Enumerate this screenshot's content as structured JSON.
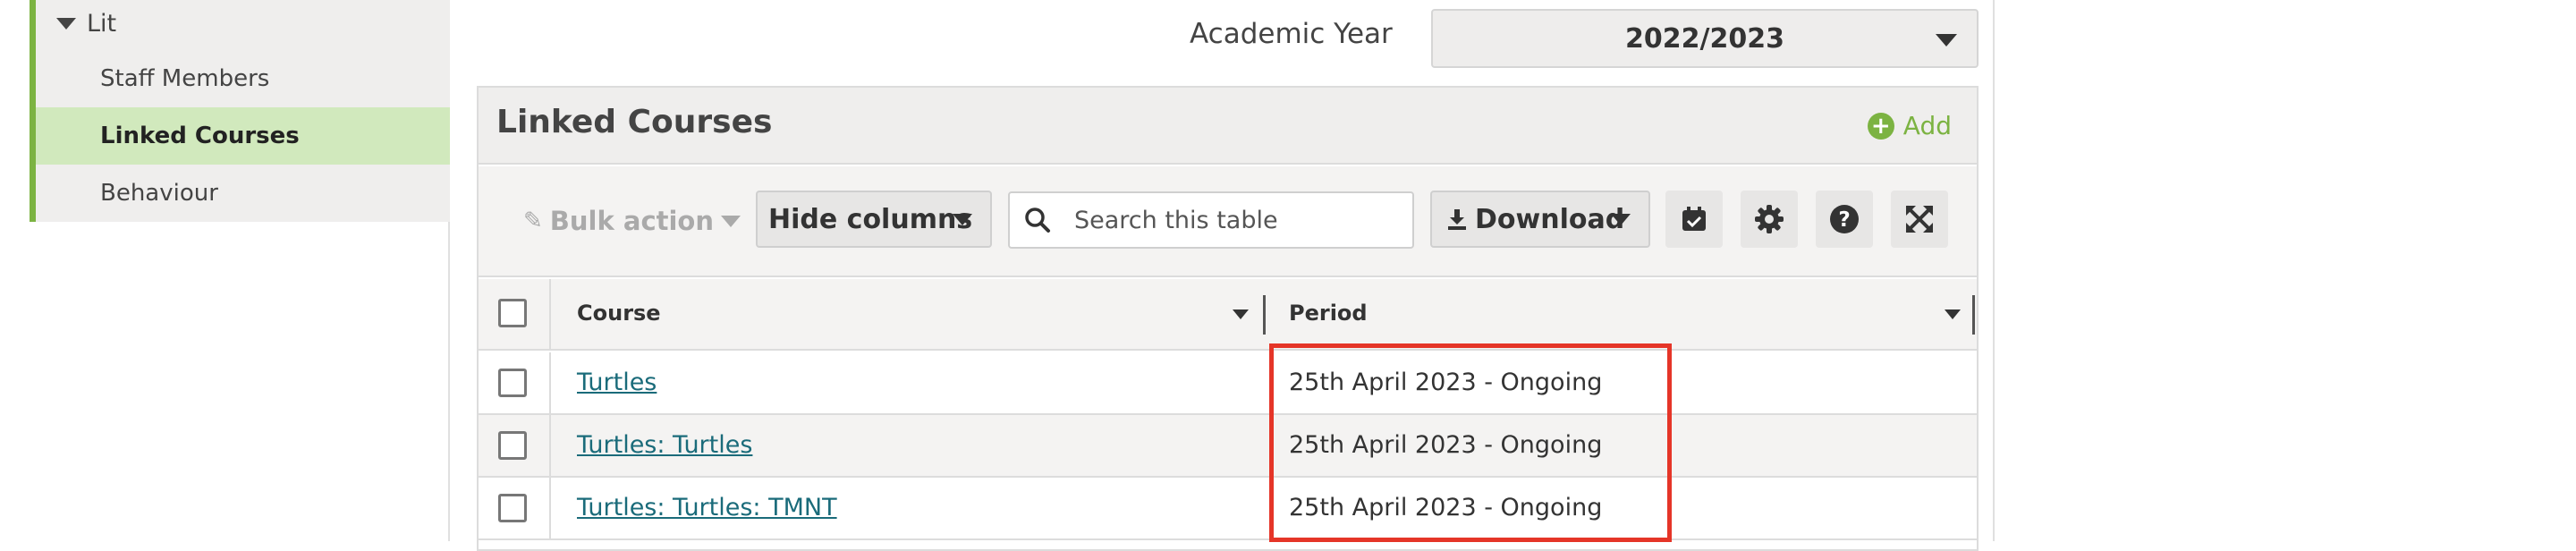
{
  "sidebar": {
    "group_label": "Lit",
    "items": [
      {
        "label": "Staff Members"
      },
      {
        "label": "Linked Courses"
      },
      {
        "label": "Behaviour"
      }
    ]
  },
  "academic_year": {
    "label": "Academic Year",
    "value": "2022/2023"
  },
  "panel": {
    "title": "Linked Courses",
    "add_label": "Add"
  },
  "toolbar": {
    "bulk_action": "Bulk action",
    "hide_columns": "Hide columns",
    "search_placeholder": "Search this table",
    "download": "Download"
  },
  "table": {
    "columns": [
      "Course",
      "Period"
    ],
    "rows": [
      {
        "course": "Turtles",
        "period": "25th April 2023 - Ongoing"
      },
      {
        "course": "Turtles: Turtles",
        "period": "25th April 2023 - Ongoing"
      },
      {
        "course": "Turtles: Turtles: TMNT",
        "period": "25th April 2023 - Ongoing"
      }
    ]
  },
  "colors": {
    "accent_green": "#7cb342",
    "active_bg": "#d1e9bd",
    "link": "#1a6b7a",
    "highlight": "#e53528"
  }
}
